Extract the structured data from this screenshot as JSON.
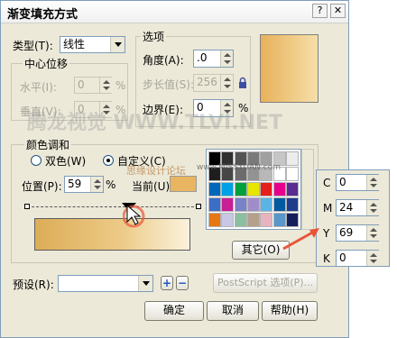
{
  "dialog": {
    "title": "渐变填充方式",
    "close_glyph": "✕",
    "help_glyph": "?"
  },
  "type_row": {
    "label": "类型(T):",
    "value": "线性"
  },
  "center_offset": {
    "title": "中心位移",
    "horizontal_label": "水平(I):",
    "horizontal_value": "0",
    "vertical_label": "垂直(V):",
    "vertical_value": "0",
    "unit": "%"
  },
  "options": {
    "title": "选项",
    "angle_label": "角度(A):",
    "angle_value": ".0",
    "steps_label": "步长值(S):",
    "steps_value": "256",
    "edge_label": "边界(E):",
    "edge_value": "0",
    "unit": "%"
  },
  "color_blend": {
    "title": "颜色调和",
    "two_color_label": "双色(W)",
    "custom_label": "自定义(C)",
    "position_label": "位置(P):",
    "position_value": "59",
    "unit": "%",
    "current_label": "当前(U):",
    "current_color": "#e9b560",
    "others_button": "其它(O)"
  },
  "palette_colors": [
    [
      "#000000",
      "#2f2f2f",
      "#545454",
      "#7a7a7a",
      "#a0a0a0",
      "#c6c6c6",
      "#ececec"
    ],
    [
      "#1e1e1e",
      "#464646",
      "#6c6c6c",
      "#929292",
      "#b8b8b8",
      "#ffffff",
      "#ffffff"
    ],
    [
      "#0068b8",
      "#00a0e6",
      "#00a03c",
      "#e6e600",
      "#e61e1e",
      "#e6008c",
      "#5a2d91"
    ],
    [
      "#3c6ec8",
      "#c81e96",
      "#7882c8",
      "#a08cc8",
      "#5ab4e6",
      "#005aa0",
      "#1e3c8c"
    ],
    [
      "#e67814",
      "#c8c8e6",
      "#8cbea0",
      "#b4a08c",
      "#e6b4be",
      "#5a96c8",
      "#141e5a"
    ]
  ],
  "cmyk": {
    "C": "0",
    "M": "24",
    "Y": "69",
    "K": "0",
    "labels": [
      "C",
      "M",
      "Y",
      "K"
    ]
  },
  "preset": {
    "label": "预设(R):",
    "value": "",
    "add_glyph": "+",
    "remove_glyph": "−"
  },
  "postscript_button": "PostScript 选项(P)...",
  "buttons": {
    "ok": "确定",
    "cancel": "取消",
    "help": "帮助(H)"
  },
  "watermarks": {
    "main": "腾龙视觉 WWW.TLVI.NET",
    "forum": "思缘设计论坛",
    "site": "www.MISSYUAN.com"
  },
  "colors": {
    "accent": "#e8553a",
    "gradient_start": "#dcad58",
    "gradient_end": "#fbf2dd"
  }
}
